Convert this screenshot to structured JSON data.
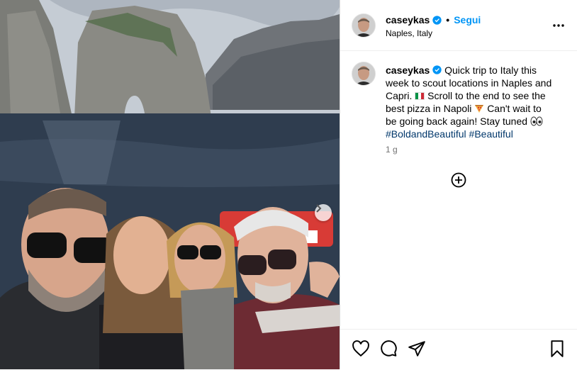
{
  "post": {
    "username": "caseykas",
    "follow_label": "Segui",
    "separator": "•",
    "location": "Naples, Italy",
    "caption_line_1": "Quick trip to Italy this",
    "caption_line_2": "week to scout locations in Naples and",
    "caption_line_3a": "Capri.",
    "caption_line_3b": "Scroll to the end to see the",
    "caption_line_4a": "best pizza in Napoli",
    "caption_line_4b": "Can't wait to",
    "caption_line_5a": "be going back again! Stay tuned",
    "hashtag_1": "#BoldandBeautiful",
    "hashtag_2": "#Beautiful",
    "time_ago": "1 g"
  },
  "icons": {
    "verified": "verified-badge-icon",
    "more": "more-options-icon",
    "add_comment": "add-circle-icon",
    "like": "heart-icon",
    "comment": "comment-icon",
    "share": "paper-plane-icon",
    "save": "bookmark-icon",
    "next": "chevron-right-icon"
  },
  "colors": {
    "accent": "#0095f6",
    "hashtag": "#00376b",
    "muted": "#737373"
  }
}
